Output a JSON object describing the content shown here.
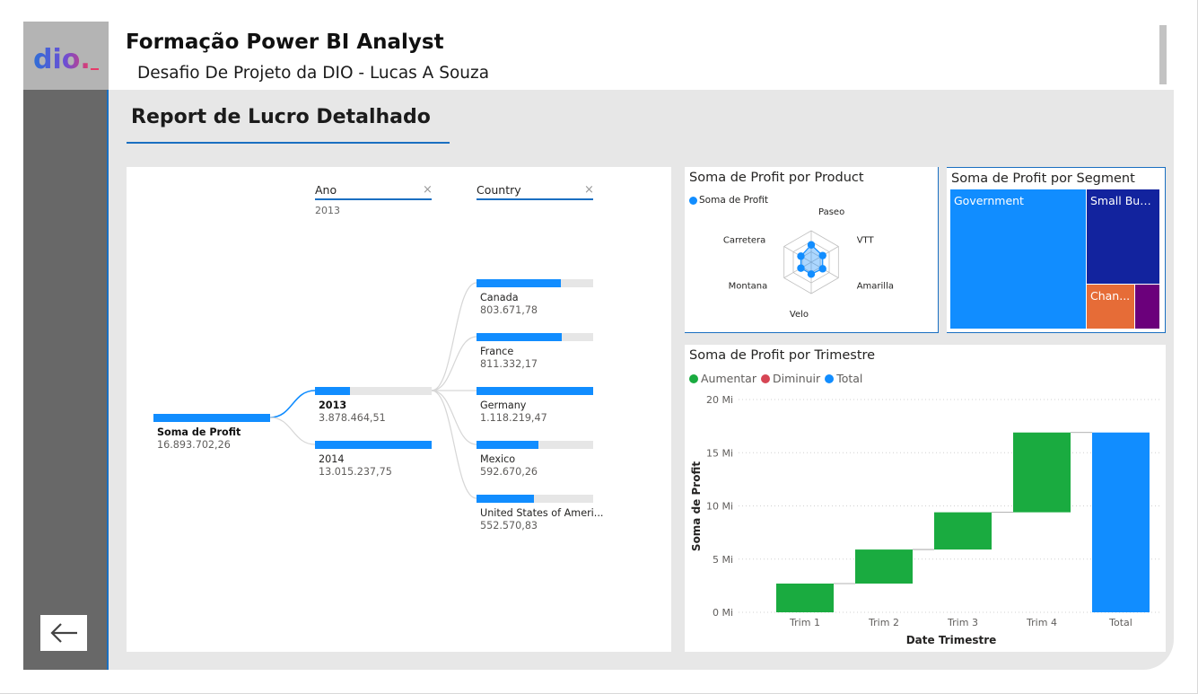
{
  "header": {
    "logo_text": "dio.",
    "title": "Formação Power BI Analyst",
    "subtitle": "Desafio De Projeto da DIO - Lucas A Souza"
  },
  "report": {
    "title": "Report de Lucro Detalhado"
  },
  "decomposition_tree": {
    "root": {
      "label": "Soma de Profit",
      "value": "16.893.702,26"
    },
    "levels": [
      {
        "header": "Ano",
        "selected": "2013",
        "close_icon": "×"
      },
      {
        "header": "Country",
        "selected": "",
        "close_icon": "×"
      }
    ],
    "years": [
      {
        "label": "2013",
        "value": "3.878.464,51",
        "fill": 0.3
      },
      {
        "label": "2014",
        "value": "13.015.237,75",
        "fill": 1.0
      }
    ],
    "countries": [
      {
        "label": "Canada",
        "value": "803.671,78",
        "fill": 0.72
      },
      {
        "label": "France",
        "value": "811.332,17",
        "fill": 0.73
      },
      {
        "label": "Germany",
        "value": "1.118.219,47",
        "fill": 1.0
      },
      {
        "label": "Mexico",
        "value": "592.670,26",
        "fill": 0.53
      },
      {
        "label": "United States of Ameri...",
        "value": "552.570,83",
        "fill": 0.49
      }
    ]
  },
  "radar": {
    "title": "Soma de Profit por Product",
    "legend": "Soma de Profit",
    "axes": [
      "Paseo",
      "VTT",
      "Amarilla",
      "Velo",
      "Montana",
      "Carretera"
    ],
    "values": [
      0.55,
      0.42,
      0.42,
      0.38,
      0.38,
      0.38
    ],
    "color": "#118dff"
  },
  "treemap": {
    "title": "Soma de Profit por Segment",
    "cells": [
      {
        "label": "Government",
        "color": "#118dff"
      },
      {
        "label": "Small Busi...",
        "color": "#12239e"
      },
      {
        "label": "Chan...",
        "color": "#e66c37"
      },
      {
        "label": "",
        "color": "#6b007b"
      }
    ]
  },
  "waterfall": {
    "title": "Soma de Profit por Trimestre",
    "legend": [
      {
        "label": "Aumentar",
        "color": "#1aab40"
      },
      {
        "label": "Diminuir",
        "color": "#d64554"
      },
      {
        "label": "Total",
        "color": "#118dff"
      }
    ],
    "ylabel": "Soma de Profit",
    "xlabel": "Date Trimestre",
    "yticks": [
      "20 Mi",
      "15 Mi",
      "10 Mi",
      "5 Mi",
      "0 Mi"
    ]
  },
  "chart_data": {
    "type": "bar",
    "subtype": "waterfall",
    "title": "Soma de Profit por Trimestre",
    "xlabel": "Date Trimestre",
    "ylabel": "Soma de Profit",
    "categories": [
      "Trim 1",
      "Trim 2",
      "Trim 3",
      "Trim 4",
      "Total"
    ],
    "series": [
      {
        "name": "Aumentar",
        "values": [
          2.7,
          3.2,
          3.5,
          7.5,
          null
        ]
      },
      {
        "name": "Total",
        "values": [
          null,
          null,
          null,
          null,
          16.9
        ]
      }
    ],
    "ylim": [
      0,
      20
    ],
    "grid": true,
    "legend": "top-left",
    "unit": "Mi"
  }
}
